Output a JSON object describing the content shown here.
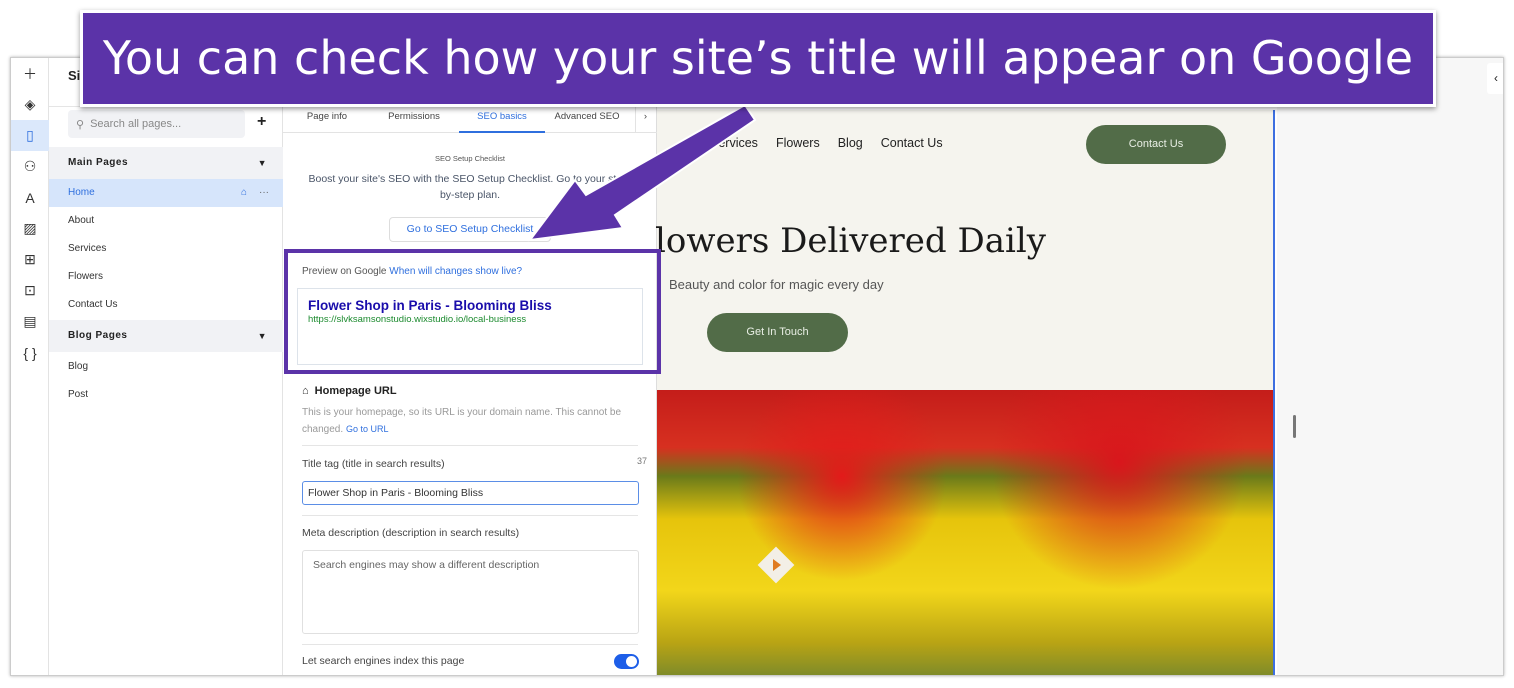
{
  "banner": {
    "text": "You can check how your site’s title will appear on Google"
  },
  "rail": {
    "icons": [
      "plus-icon",
      "layers-icon",
      "pages-icon",
      "connections-icon",
      "typography-icon",
      "media-icon",
      "apps-icon",
      "business-apps-icon",
      "table-icon",
      "code-icon"
    ]
  },
  "pages_panel": {
    "title": "Si",
    "search_placeholder": "Search all pages...",
    "add_label": "+",
    "main_section": "Main Pages",
    "main_pages": [
      "Home",
      "About",
      "Services",
      "Flowers",
      "Contact Us"
    ],
    "blog_section": "Blog Pages",
    "blog_pages": [
      "Blog",
      "Post"
    ]
  },
  "seo_panel": {
    "tabs": [
      "Page info",
      "Permissions",
      "SEO basics",
      "Advanced SEO"
    ],
    "active_tab": "SEO basics",
    "checklist_title": "SEO Setup Checklist",
    "checklist_text": "Boost your site's SEO with the SEO Setup Checklist. Go to your step-by-step plan.",
    "checklist_button": "Go to SEO Setup Checklist",
    "preview_label": "Preview on Google",
    "preview_link": "When will changes show live?",
    "preview_title": "Flower Shop in Paris - Blooming Bliss",
    "preview_url": "https://slvksamsonstudio.wixstudio.io/local-business",
    "homepage_url_title": "Homepage URL",
    "homepage_url_text": "This is your homepage, so its URL is your domain name. This cannot be changed.",
    "go_to_url": "Go to URL",
    "title_tag_label": "Title tag (title in search results)",
    "title_tag_count": "37",
    "title_tag_value": "Flower Shop in Paris - Blooming Bliss",
    "meta_label": "Meta description (description in search results)",
    "meta_placeholder": "Search engines may show a different description",
    "index_label": "Let search engines index this page",
    "index_enabled": true
  },
  "site": {
    "nav": [
      "Services",
      "Flowers",
      "Blog",
      "Contact Us"
    ],
    "contact_button": "Contact Us",
    "headline": "lowers Delivered Daily",
    "subheadline": "Beauty and color for magic every day",
    "cta_button": "Get In Touch"
  },
  "colors": {
    "accent": "#5b33a8",
    "wix_blue": "#2f6fde",
    "site_green": "#526c48"
  }
}
